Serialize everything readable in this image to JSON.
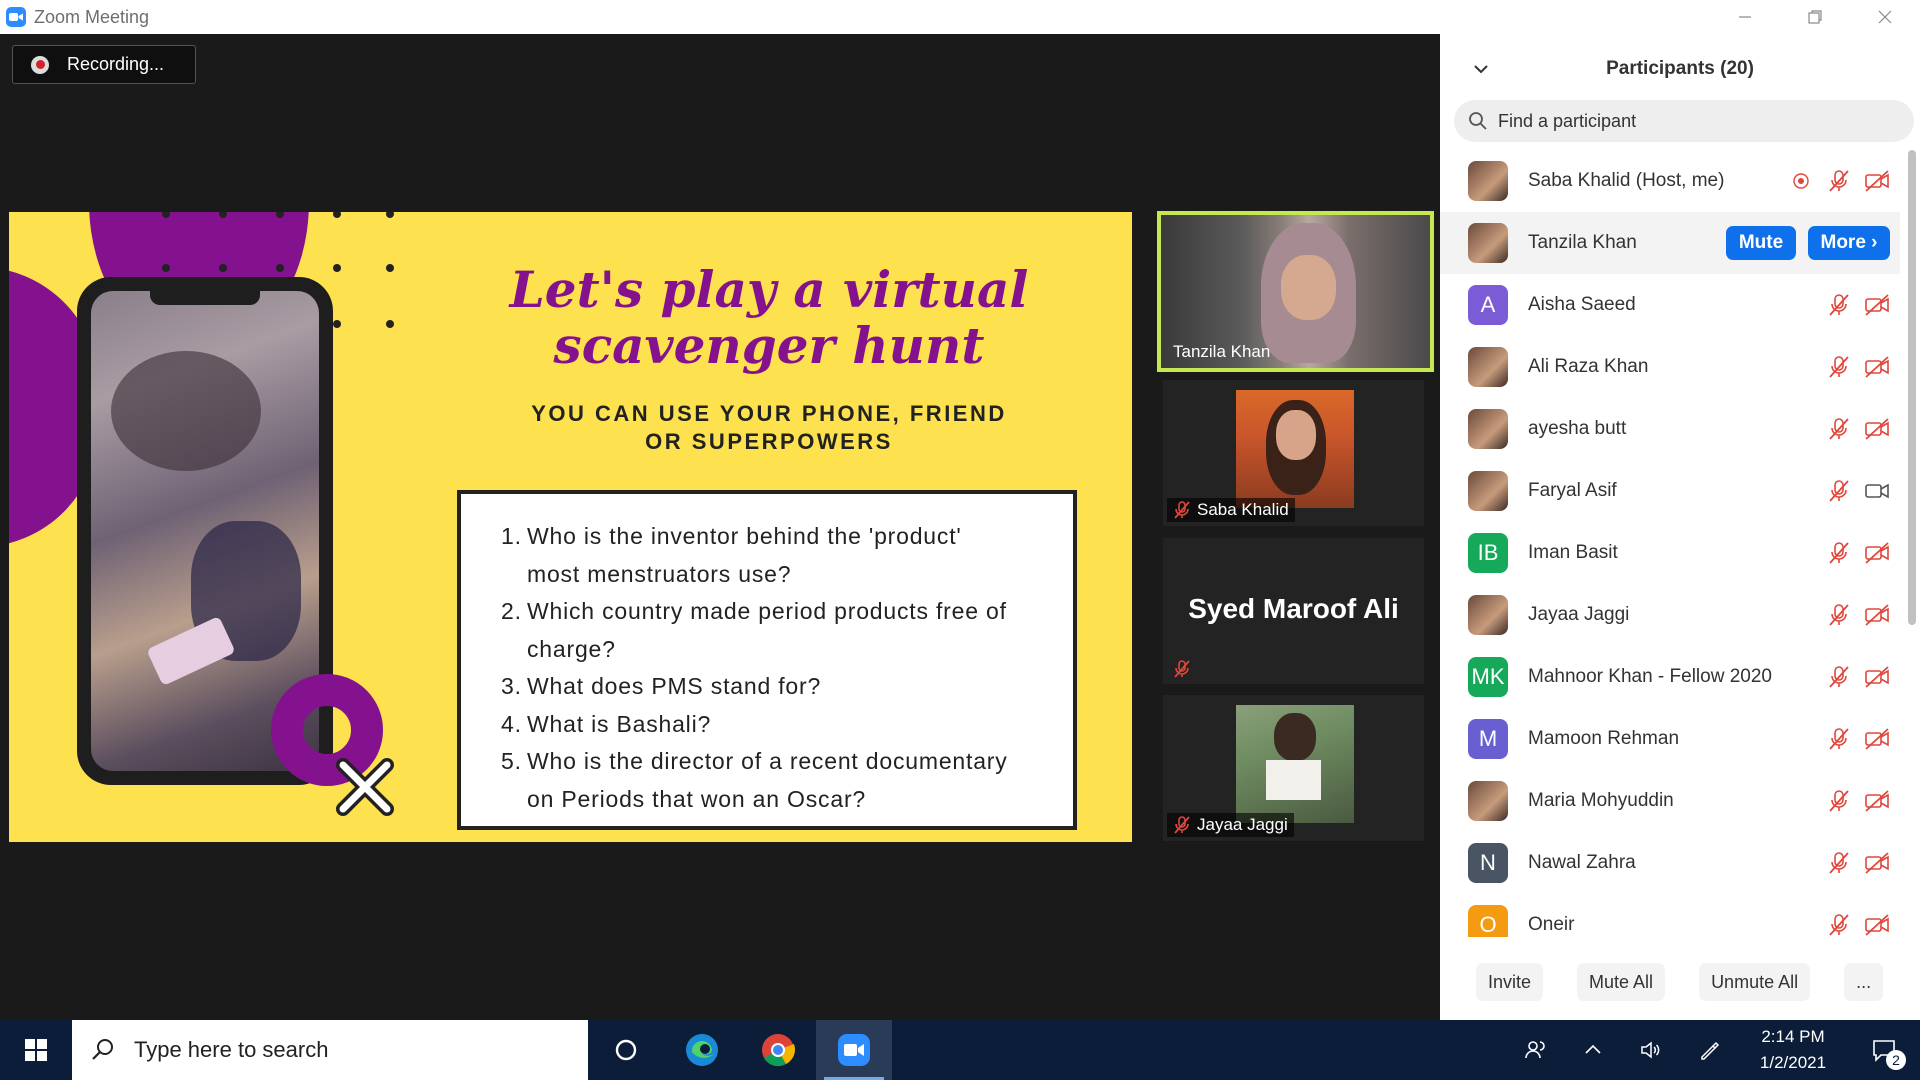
{
  "window": {
    "title": "Zoom Meeting"
  },
  "recording": {
    "label": "Recording..."
  },
  "slide": {
    "title_line1": "Let's play a virtual",
    "title_line2": "scavenger hunt",
    "subtitle_line1": "YOU CAN USE YOUR PHONE, FRIEND",
    "subtitle_line2": "OR SUPERPOWERS",
    "questions": [
      {
        "num": "1.",
        "line1": "Who is the inventor behind the 'product'",
        "line2": "most menstruators use?"
      },
      {
        "num": "2.",
        "line1": "Which country made period products free of",
        "line2": "charge?"
      },
      {
        "num": "3.",
        "line1": "What does PMS stand for?",
        "line2": ""
      },
      {
        "num": "4.",
        "line1": "What is Bashali?",
        "line2": ""
      },
      {
        "num": "5.",
        "line1": "Who is the director of a recent documentary",
        "line2": "on Periods that won an Oscar?"
      }
    ]
  },
  "tiles": [
    {
      "name": "Tanzila Khan"
    },
    {
      "name": "Saba Khalid"
    },
    {
      "name": "Syed Maroof Ali"
    },
    {
      "name": "Jayaa Jaggi"
    }
  ],
  "participants": {
    "title": "Participants (20)",
    "search_placeholder": "Find a participant",
    "mute_label": "Mute",
    "more_label": "More ›",
    "list": [
      {
        "name": "Saba Khalid (Host, me)",
        "avatar": "",
        "color": ""
      },
      {
        "name": "Tanzila Khan",
        "avatar": "",
        "color": ""
      },
      {
        "name": "Aisha Saeed",
        "avatar": "A",
        "color": "#7b5cd6"
      },
      {
        "name": "Ali Raza Khan",
        "avatar": "",
        "color": ""
      },
      {
        "name": "ayesha butt",
        "avatar": "",
        "color": ""
      },
      {
        "name": "Faryal Asif",
        "avatar": "",
        "color": ""
      },
      {
        "name": "Iman Basit",
        "avatar": "IB",
        "color": "#17a95a"
      },
      {
        "name": "Jayaa Jaggi",
        "avatar": "",
        "color": ""
      },
      {
        "name": "Mahnoor Khan - Fellow 2020",
        "avatar": "MK",
        "color": "#17a95a"
      },
      {
        "name": "Mamoon Rehman",
        "avatar": "M",
        "color": "#6a5fd0"
      },
      {
        "name": "Maria Mohyuddin",
        "avatar": "",
        "color": ""
      },
      {
        "name": "Nawal Zahra",
        "avatar": "N",
        "color": "#4a5563"
      },
      {
        "name": "Oneir",
        "avatar": "O",
        "color": "#f59b12"
      }
    ],
    "footer": {
      "invite": "Invite",
      "mute_all": "Mute All",
      "unmute_all": "Unmute All",
      "more": "..."
    }
  },
  "taskbar": {
    "search_placeholder": "Type here to search",
    "time": "2:14 PM",
    "date": "1/2/2021",
    "notifications": "2"
  }
}
